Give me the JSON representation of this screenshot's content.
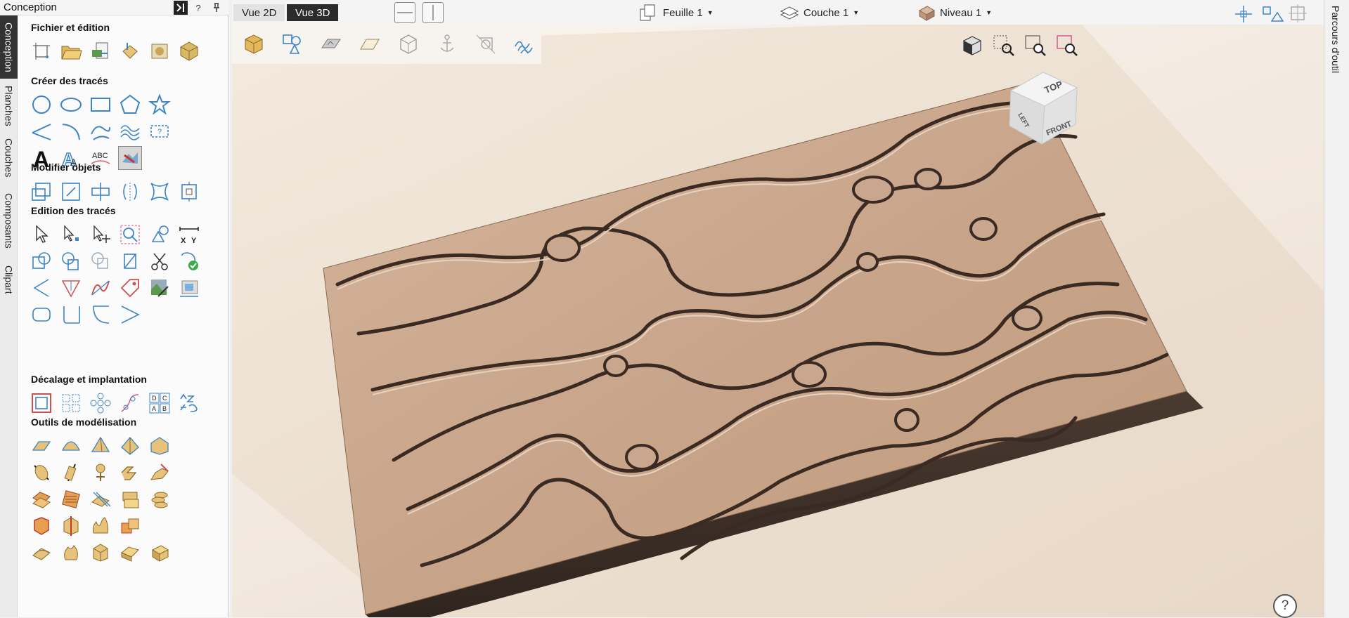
{
  "panel": {
    "title": "Conception",
    "help_label": "?",
    "pin_label": "⊥"
  },
  "vtabs": [
    {
      "label": "Conception",
      "active": true
    },
    {
      "label": "Planches"
    },
    {
      "label": "Couches"
    },
    {
      "label": "Composants"
    },
    {
      "label": "Clipart"
    }
  ],
  "sections": {
    "fichier": "Fichier et édition",
    "creer": "Créer des tracés",
    "modifier": "Modifier objets",
    "edition": "Edition des tracés",
    "decalage": "Décalage et implantation",
    "outils": "Outils de modélisation"
  },
  "toolbar": {
    "vue2d": "Vue 2D",
    "vue3d": "Vue 3D",
    "feuille": "Feuille 1",
    "couche": "Couche 1",
    "niveau": "Niveau 1"
  },
  "viewcube": {
    "top": "TOP",
    "left": "LEFT",
    "front": "FRONT"
  },
  "right_strip": "Parcours d'outil",
  "help": "?",
  "colors": {
    "accent": "#3d85c6",
    "wood": "#c9a78f",
    "gold": "#e3b75a"
  }
}
